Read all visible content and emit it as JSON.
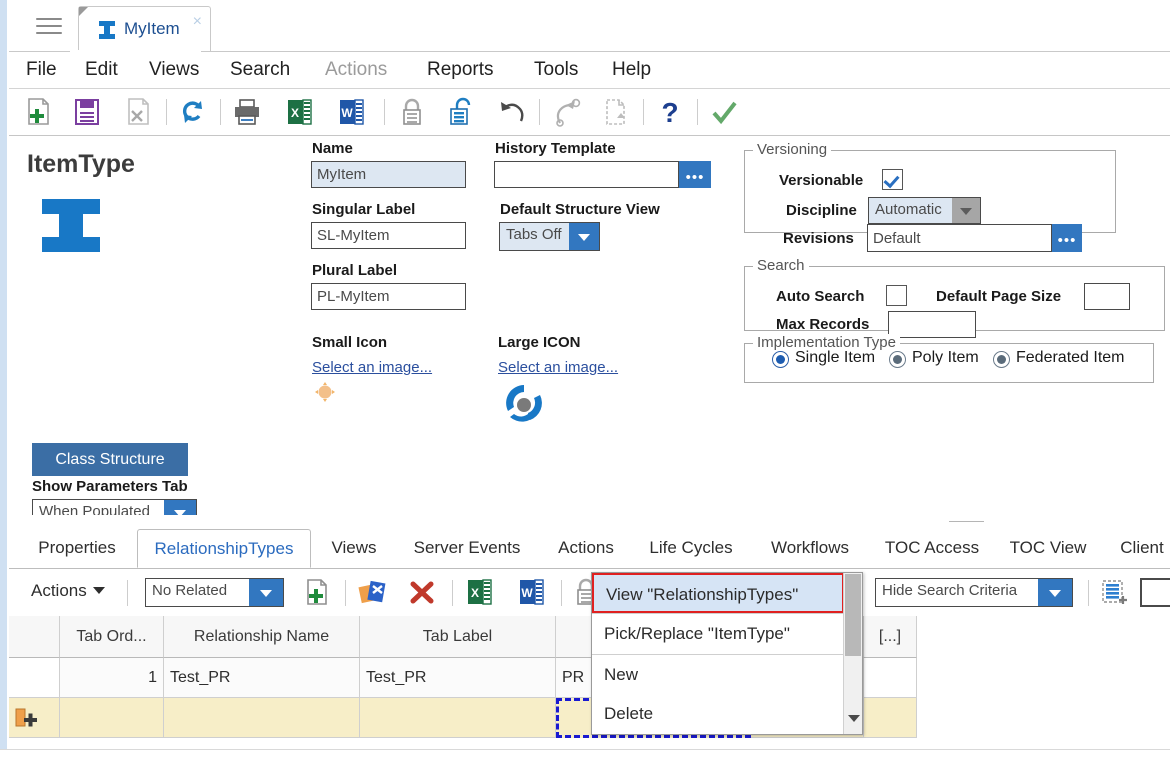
{
  "window": {
    "tab_label": "MyItem",
    "tab_close": "×",
    "menu": [
      "File",
      "Edit",
      "Views",
      "Search",
      "Actions",
      "Reports",
      "Tools",
      "Help"
    ],
    "menu_disabled": [
      "Actions"
    ]
  },
  "toolbar": {
    "buttons": [
      {
        "name": "new-icon",
        "title": "New"
      },
      {
        "name": "save-icon",
        "title": "Save"
      },
      {
        "name": "delete-icon",
        "title": "Delete"
      },
      {
        "name": "refresh-icon",
        "title": "Refresh"
      },
      {
        "name": "print-icon",
        "title": "Print"
      },
      {
        "name": "export-excel-icon",
        "title": "Export to Excel"
      },
      {
        "name": "export-word-icon",
        "title": "Export to Word"
      },
      {
        "name": "lock-icon",
        "title": "Lock"
      },
      {
        "name": "unlock-icon",
        "title": "Unlock"
      },
      {
        "name": "undo-icon",
        "title": "Undo"
      },
      {
        "name": "redo-icon",
        "title": "Redo"
      },
      {
        "name": "copy-icon",
        "title": "Copy"
      },
      {
        "name": "help-icon",
        "title": "Help"
      },
      {
        "name": "done-icon",
        "title": "Done"
      }
    ]
  },
  "form": {
    "title": "ItemType",
    "class_structure_button": "Class Structure",
    "show_parameters_tab_label": "Show Parameters Tab",
    "show_parameters_tab_value": "When Populated",
    "name_label": "Name",
    "name_value": "MyItem",
    "singular_label_label": "Singular Label",
    "singular_label_value": "SL-MyItem",
    "plural_label_label": "Plural Label",
    "plural_label_value": "PL-MyItem",
    "small_icon_label": "Small Icon",
    "small_icon_link": "Select an image...",
    "large_icon_label": "Large ICON",
    "large_icon_link": "Select an image...",
    "history_template_label": "History Template",
    "history_template_value": "",
    "history_template_picker": "•••",
    "default_structure_view_label": "Default Structure View",
    "default_structure_view_value": "Tabs Off"
  },
  "versioning": {
    "caption": "Versioning",
    "versionable_label": "Versionable",
    "versionable_checked": true,
    "discipline_label": "Discipline",
    "discipline_value": "Automatic",
    "revisions_label": "Revisions",
    "revisions_value": "Default",
    "revisions_picker": "•••"
  },
  "search_group": {
    "caption": "Search",
    "auto_search_label": "Auto Search",
    "auto_search_checked": false,
    "default_page_size_label": "Default Page Size",
    "default_page_size_value": "",
    "max_records_label": "Max Records",
    "max_records_value": ""
  },
  "implementation": {
    "caption": "Implementation Type",
    "options": [
      "Single Item",
      "Poly Item",
      "Federated Item"
    ],
    "selected": "Single Item"
  },
  "bottom_tabs": {
    "items": [
      "Properties",
      "RelationshipTypes",
      "Views",
      "Server Events",
      "Actions",
      "Life Cycles",
      "Workflows",
      "TOC Access",
      "TOC View",
      "Client"
    ],
    "active": "RelationshipTypes"
  },
  "rel_toolbar": {
    "actions_label": "Actions",
    "filter_value": "No Related",
    "search_criteria_value": "Hide Search Criteria",
    "buttons": [
      {
        "name": "new-relationship-icon"
      },
      {
        "name": "pick-related-icon"
      },
      {
        "name": "delete-relationship-icon"
      },
      {
        "name": "export-excel-icon"
      },
      {
        "name": "export-word-icon"
      },
      {
        "name": "lock-icon"
      },
      {
        "name": "new-view-icon"
      }
    ]
  },
  "context_menu": {
    "items": [
      {
        "label": "View \"RelationshipTypes\"",
        "selected": true
      },
      {
        "label": "Pick/Replace \"ItemType\"",
        "selected": false
      },
      {
        "label": "New",
        "selected": false
      },
      {
        "label": "Delete",
        "selected": false
      }
    ]
  },
  "grid": {
    "columns": [
      "",
      "Tab Ord...",
      "Relationship Name",
      "Tab Label",
      "",
      "[...]"
    ],
    "rows": [
      {
        "marker": "",
        "tab_order": "1",
        "relationship_name": "Test_PR",
        "tab_label": "Test_PR",
        "extra": "PR",
        "last": ""
      },
      {
        "marker": "new-row-icon",
        "tab_order": "",
        "relationship_name": "",
        "tab_label": "",
        "extra": "",
        "last": ""
      }
    ]
  },
  "colors": {
    "accent_blue": "#3277c0",
    "logo_blue": "#1878c6",
    "button_blue": "#3b6ea5",
    "tab_active_text": "#2b6bbf",
    "readonly_field": "#dde7f2",
    "new_row": "#f7eec8",
    "selection_red": "#e02020",
    "selection_fill": "#d6e4f5",
    "dashed_cell": "#1a1ad0",
    "rail": "#cfe0f2"
  }
}
